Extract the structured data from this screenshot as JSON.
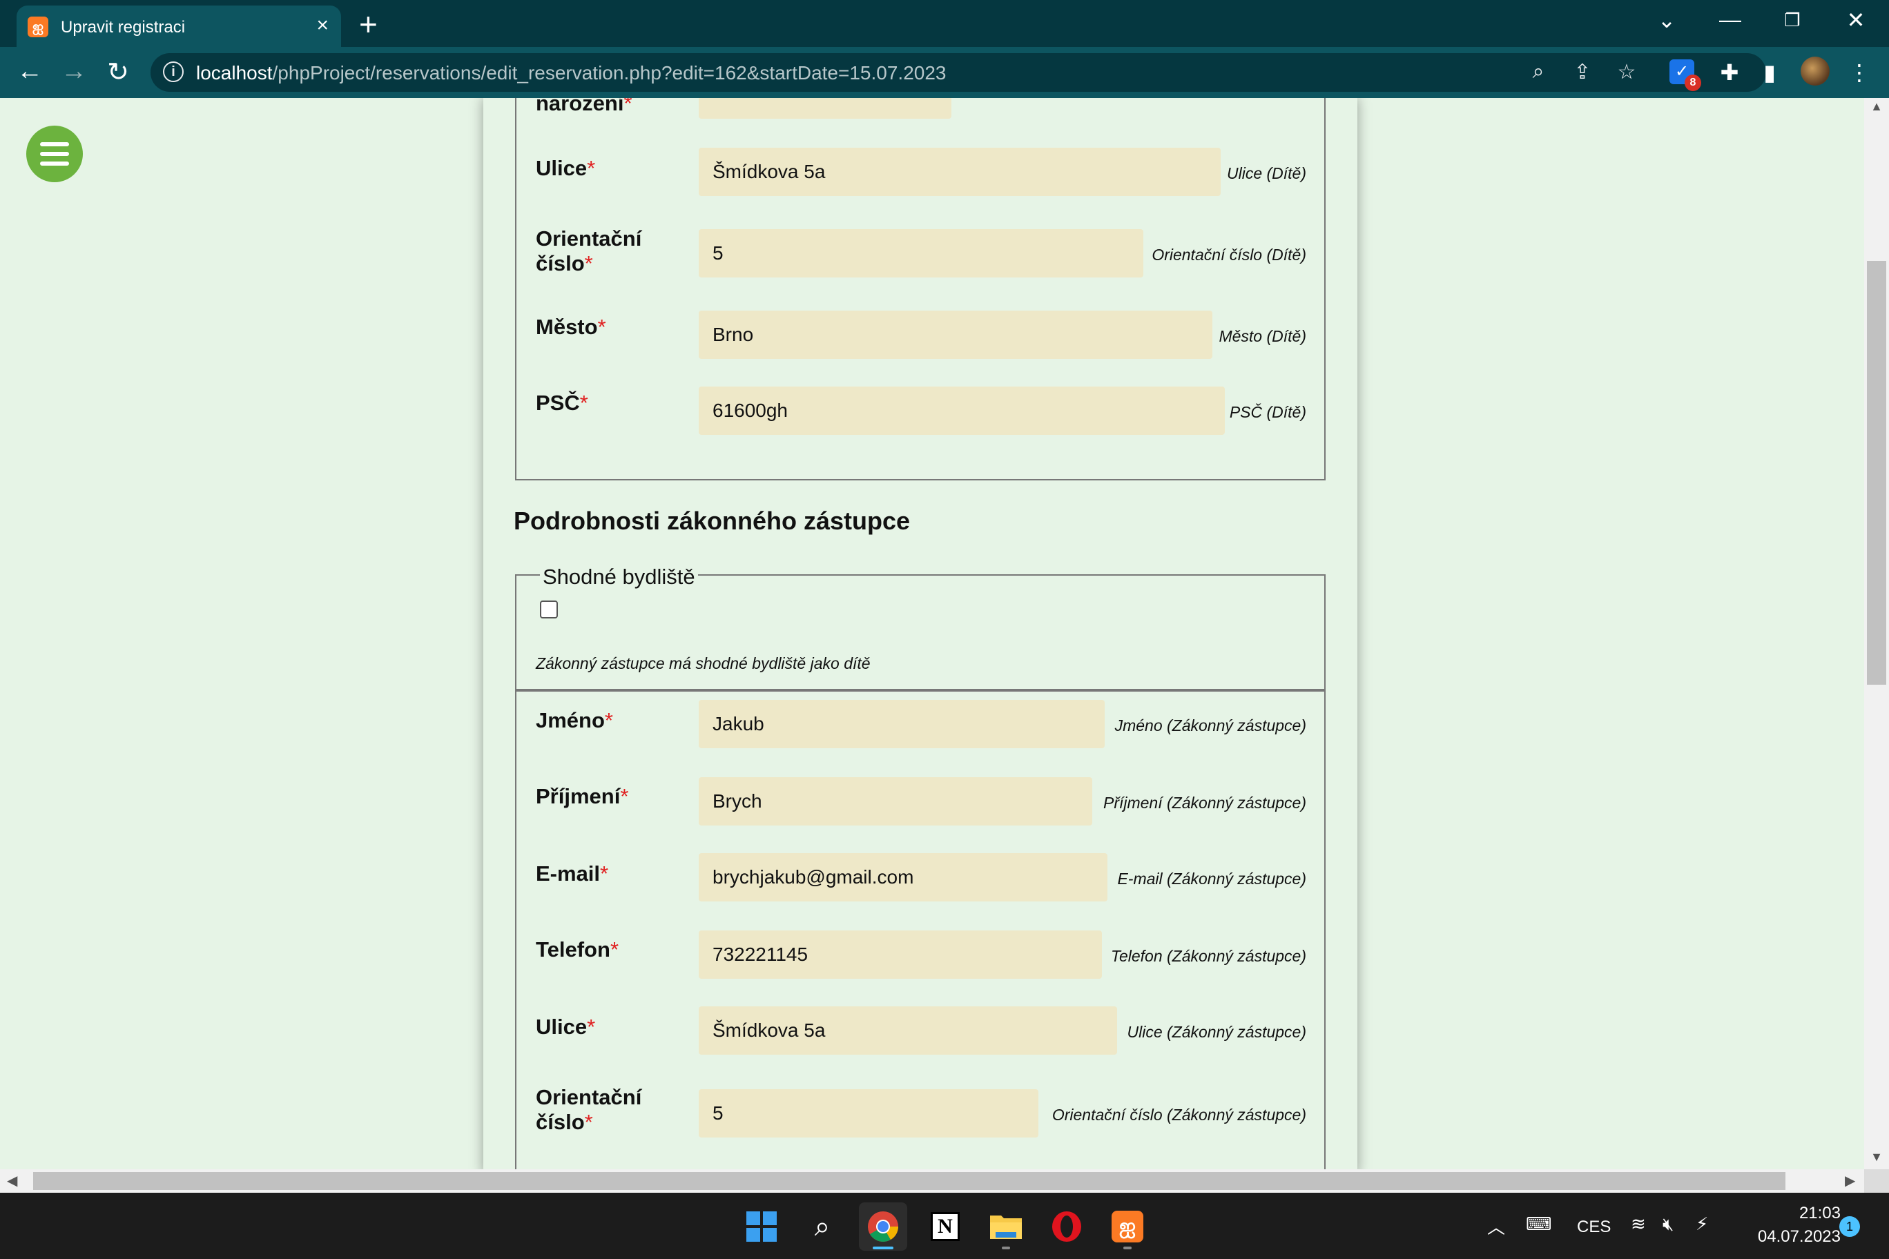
{
  "browser": {
    "tab_title": "Upravit registraci",
    "url_host": "localhost",
    "url_rest": "/phpProject/reservations/edit_reservation.php?edit=162&startDate=15.07.2023",
    "extension_badge": "8"
  },
  "child_section": {
    "partial_label": "narození",
    "rows": [
      {
        "label": "Ulice",
        "value": "Šmídkova 5a",
        "hint": "Ulice (Dítě)"
      },
      {
        "label_line1": "Orientační",
        "label_line2": "číslo",
        "value": "5",
        "hint": "Orientační číslo (Dítě)"
      },
      {
        "label": "Město",
        "value": "Brno",
        "hint": "Město (Dítě)"
      },
      {
        "label": "PSČ",
        "value": "61600gh",
        "hint": "PSČ (Dítě)"
      }
    ]
  },
  "legal_section": {
    "heading": "Podrobnosti zákonného zástupce",
    "same_address": {
      "legend": "Shodné bydliště",
      "checked": false,
      "hint": "Zákonný zástupce má shodné bydliště jako dítě"
    },
    "rows": [
      {
        "label": "Jméno",
        "value": "Jakub",
        "hint": "Jméno (Zákonný zástupce)"
      },
      {
        "label": "Příjmení",
        "value": "Brych",
        "hint": "Příjmení (Zákonný zástupce)"
      },
      {
        "label": "E-mail",
        "value": "brychjakub@gmail.com",
        "hint": "E-mail (Zákonný zástupce)"
      },
      {
        "label": "Telefon",
        "value": "732221145",
        "hint": "Telefon (Zákonný zástupce)"
      },
      {
        "label": "Ulice",
        "value": "Šmídkova 5a",
        "hint": "Ulice (Zákonný zástupce)"
      },
      {
        "label_line1": "Orientační",
        "label_line2": "číslo",
        "value": "5",
        "hint": "Orientační číslo (Zákonný zástupce)"
      }
    ]
  },
  "required_mark": "*",
  "taskbar": {
    "language": "CES",
    "time": "21:03",
    "date": "04.07.2023",
    "notifications": "1"
  }
}
